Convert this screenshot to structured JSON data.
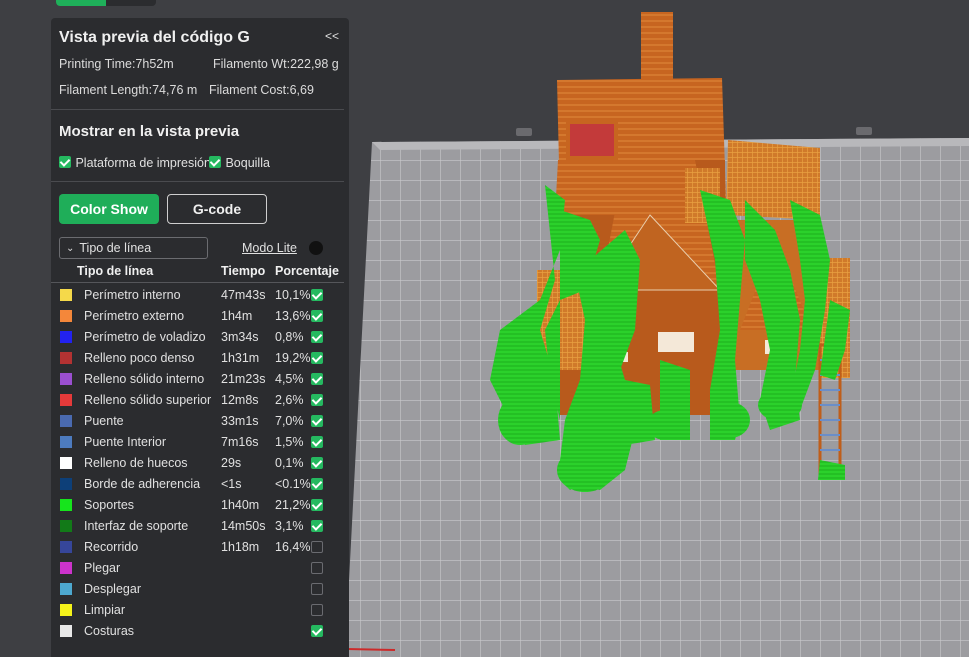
{
  "preview": {
    "title": "Vista previa del código G",
    "collapse_label": "<<",
    "printing_time": "Printing Time:7h52m",
    "filament_weight": "Filamento Wt:222,98 g",
    "filament_length": "Filament Length:74,76 m",
    "filament_cost": "Filament Cost:6,69"
  },
  "show_in_preview": {
    "title": "Mostrar en la vista previa",
    "options": [
      {
        "label": "Plataforma de impresión",
        "checked": true
      },
      {
        "label": "Boquilla",
        "checked": true
      }
    ]
  },
  "modes": {
    "color_show": "Color Show",
    "gcode": "G-code"
  },
  "filter": {
    "selected": "Tipo de línea",
    "modo_lite": "Modo Lite"
  },
  "legend": {
    "headers": [
      "Tipo de línea",
      "Tiempo",
      "Porcentaje"
    ],
    "rows": [
      {
        "name": "Perímetro interno",
        "time": "47m43s",
        "pct": "10,1%",
        "color": "#f5d94a",
        "checked": true
      },
      {
        "name": "Perímetro externo",
        "time": "1h4m",
        "pct": "13,6%",
        "color": "#f4873a",
        "checked": true
      },
      {
        "name": "Perímetro de voladizo",
        "time": "3m34s",
        "pct": "0,8%",
        "color": "#2222f0",
        "checked": true
      },
      {
        "name": "Relleno poco denso",
        "time": "1h31m",
        "pct": "19,2%",
        "color": "#b33232",
        "checked": true
      },
      {
        "name": "Relleno sólido interno",
        "time": "21m23s",
        "pct": "4,5%",
        "color": "#9a4fd0",
        "checked": true
      },
      {
        "name": "Relleno sólido superior",
        "time": "12m8s",
        "pct": "2,6%",
        "color": "#e53a3a",
        "checked": true
      },
      {
        "name": "Puente",
        "time": "33m1s",
        "pct": "7,0%",
        "color": "#4a6ab0",
        "checked": true
      },
      {
        "name": "Puente Interior",
        "time": "7m16s",
        "pct": "1,5%",
        "color": "#4d7bbf",
        "checked": true
      },
      {
        "name": "Relleno de huecos",
        "time": "29s",
        "pct": "0,1%",
        "color": "#ffffff",
        "checked": true
      },
      {
        "name": "Borde de adherencia",
        "time": "<1s",
        "pct": "<0.1%",
        "color": "#0d3f78",
        "checked": true
      },
      {
        "name": "Soportes",
        "time": "1h40m",
        "pct": "21,2%",
        "color": "#16e51c",
        "checked": true
      },
      {
        "name": "Interfaz de soporte",
        "time": "14m50s",
        "pct": "3,1%",
        "color": "#127a18",
        "checked": true
      },
      {
        "name": "Recorrido",
        "time": "1h18m",
        "pct": "16,4%",
        "color": "#36469a",
        "checked": false
      },
      {
        "name": "Plegar",
        "time": "",
        "pct": "",
        "color": "#cc33cc",
        "checked": false
      },
      {
        "name": "Desplegar",
        "time": "",
        "pct": "",
        "color": "#4da8cf",
        "checked": false
      },
      {
        "name": "Limpiar",
        "time": "",
        "pct": "",
        "color": "#f4f21a",
        "checked": false
      },
      {
        "name": "Costuras",
        "time": "",
        "pct": "",
        "color": "#e8e8e8",
        "checked": true
      }
    ]
  },
  "colors": {
    "accent": "#1fae59",
    "panel_bg": "#2b2c2f",
    "model_orange": "#c8631f",
    "support_green": "#2bd12b"
  }
}
